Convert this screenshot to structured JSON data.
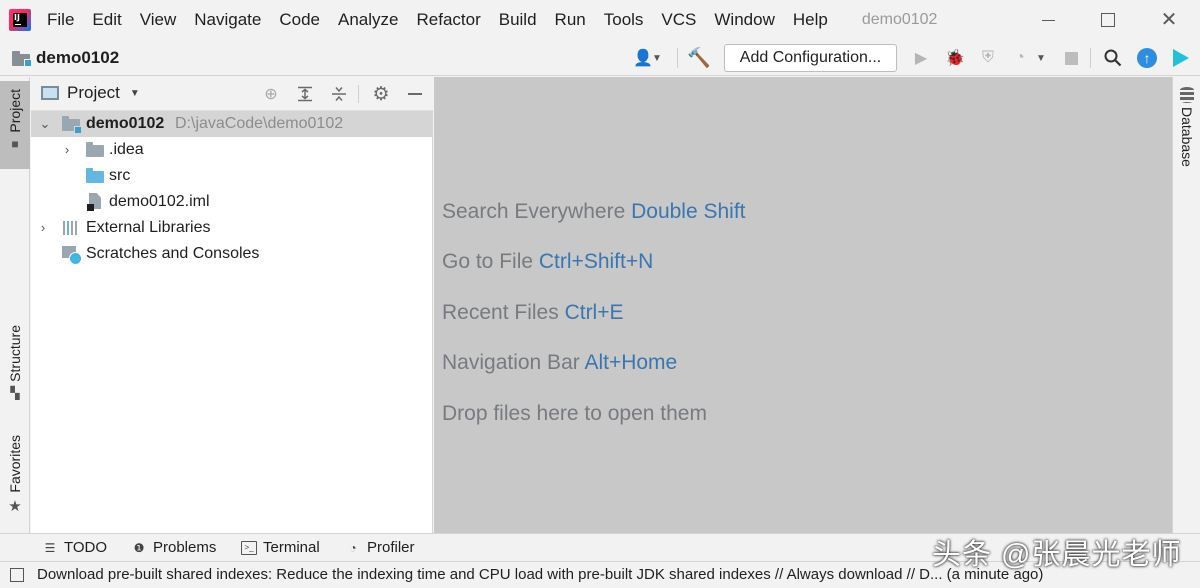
{
  "menu": {
    "items": [
      "File",
      "Edit",
      "View",
      "Navigate",
      "Code",
      "Analyze",
      "Refactor",
      "Build",
      "Run",
      "Tools",
      "VCS",
      "Window",
      "Help"
    ],
    "window_title": "demo0102"
  },
  "navbar": {
    "breadcrumb": "demo0102",
    "add_configuration_label": "Add Configuration..."
  },
  "left_strip": {
    "project_label": "Project",
    "structure_label": "Structure",
    "favorites_label": "Favorites"
  },
  "right_strip": {
    "database_label": "Database"
  },
  "project_panel": {
    "title": "Project",
    "tree": {
      "root": {
        "label": "demo0102",
        "path": "D:\\javaCode\\demo0102"
      },
      "idea": ".idea",
      "src": "src",
      "iml": "demo0102.iml",
      "external_libraries": "External Libraries",
      "scratches": "Scratches and Consoles"
    }
  },
  "editor": {
    "hints": [
      {
        "text": "Search Everywhere",
        "shortcut": "Double Shift"
      },
      {
        "text": "Go to File",
        "shortcut": "Ctrl+Shift+N"
      },
      {
        "text": "Recent Files",
        "shortcut": "Ctrl+E"
      },
      {
        "text": "Navigation Bar",
        "shortcut": "Alt+Home"
      },
      {
        "text": "Drop files here to open them",
        "shortcut": ""
      }
    ]
  },
  "bottom_tools": {
    "todo": "TODO",
    "problems": "Problems",
    "terminal": "Terminal",
    "profiler": "Profiler"
  },
  "statusbar": {
    "message": "Download pre-built shared indexes: Reduce the indexing time and CPU load with pre-built JDK shared indexes // Always download // D... (a minute ago)"
  },
  "watermark": "头条 @张晨光老师",
  "colors": {
    "shortcut_blue": "#3a76b0",
    "editor_bg": "#c8c8c8",
    "selection": "#d5d5d5"
  }
}
